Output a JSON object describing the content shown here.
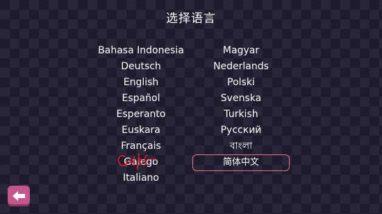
{
  "title": "选择语言",
  "languages_left": [
    "Bahasa Indonesia",
    "Deutsch",
    "English",
    "Español",
    "Esperanto",
    "Euskara",
    "Français",
    "Galego",
    "Italiano"
  ],
  "languages_right": [
    "Magyar",
    "Nederlands",
    "Polski",
    "Svenska",
    "Turkish",
    "Русский",
    "বাংলা",
    "简体中文"
  ],
  "selected_language": "简体中文",
  "back_button": {
    "icon": "arrow-left-icon"
  },
  "colors": {
    "background": "#1f1b2c",
    "checker": "#2a2639",
    "accent": "#c2578e",
    "selection_border": "#e0758f",
    "scribble": "#e0202a"
  }
}
